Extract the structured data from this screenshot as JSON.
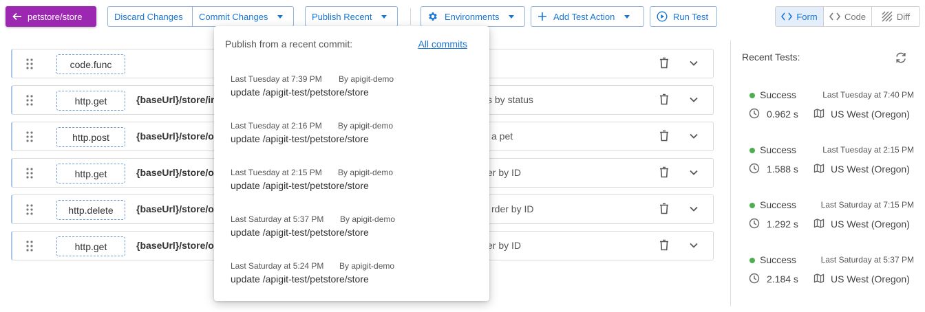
{
  "toolbar": {
    "repo_label": "petstore/store",
    "discard_label": "Discard Changes",
    "commit_label": "Commit Changes",
    "publish_label": "Publish Recent",
    "environments_label": "Environments",
    "add_action_label": "Add Test Action",
    "run_label": "Run Test",
    "views": [
      {
        "label": "Form",
        "icon": "code-brackets-icon",
        "active": true
      },
      {
        "label": "Code",
        "icon": "code-brackets-icon",
        "active": false
      },
      {
        "label": "Diff",
        "icon": "hatch-icon",
        "active": false
      }
    ]
  },
  "actions": [
    {
      "func": "code.func",
      "url": "",
      "desc": ""
    },
    {
      "func": "http.get",
      "url": "{baseUrl}/store/in",
      "desc": "s by status"
    },
    {
      "func": "http.post",
      "url": "{baseUrl}/store/or",
      "desc": "a pet"
    },
    {
      "func": "http.get",
      "url": "{baseUrl}/store/or",
      "desc": "er by ID"
    },
    {
      "func": "http.delete",
      "url": "{baseUrl}/store/or",
      "desc": "rder by ID"
    },
    {
      "func": "http.get",
      "url": "{baseUrl}/store/or",
      "desc": "er by ID"
    }
  ],
  "recent_tests": {
    "title": "Recent Tests:",
    "items": [
      {
        "status": "Success",
        "time": "Last Tuesday at 7:40 PM",
        "duration": "0.962 s",
        "region": "US West (Oregon)"
      },
      {
        "status": "Success",
        "time": "Last Tuesday at 2:15 PM",
        "duration": "1.588 s",
        "region": "US West (Oregon)"
      },
      {
        "status": "Success",
        "time": "Last Saturday at 7:15 PM",
        "duration": "1.292 s",
        "region": "US West (Oregon)"
      },
      {
        "status": "Success",
        "time": "Last Saturday at 5:37 PM",
        "duration": "2.184 s",
        "region": "US West (Oregon)"
      }
    ]
  },
  "publish_dropdown": {
    "heading": "Publish from a recent commit:",
    "all_commits_label": "All commits",
    "commits": [
      {
        "date": "Last Tuesday at 7:39 PM",
        "author": "By apigit-demo",
        "message": "update /apigit-test/petstore/store"
      },
      {
        "date": "Last Tuesday at 2:16 PM",
        "author": "By apigit-demo",
        "message": "update /apigit-test/petstore/store"
      },
      {
        "date": "Last Tuesday at 2:15 PM",
        "author": "By apigit-demo",
        "message": "update /apigit-test/petstore/store"
      },
      {
        "date": "Last Saturday at 5:37 PM",
        "author": "By apigit-demo",
        "message": "update /apigit-test/petstore/store"
      },
      {
        "date": "Last Saturday at 5:24 PM",
        "author": "By apigit-demo",
        "message": "update /apigit-test/petstore/store"
      }
    ]
  },
  "colors": {
    "primary": "#1976d2",
    "repo_button": "#9c27b0",
    "success": "#4caf50"
  }
}
